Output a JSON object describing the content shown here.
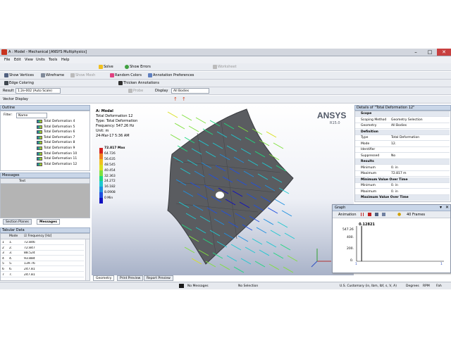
{
  "window": {
    "title": "A : Model - Mechanical [ANSYS Multiphysics]"
  },
  "menu": [
    "File",
    "Edit",
    "View",
    "Units",
    "Tools",
    "Help"
  ],
  "toolbar1": {
    "solve": "Solve",
    "show_errors": "Show Errors",
    "worksheet": "Worksheet"
  },
  "toolbar2": {
    "show_vertices": "Show Vertices",
    "wireframe": "Wireframe",
    "show_mesh": "Show Mesh",
    "random_colors": "Random Colors",
    "annotation_prefs": "Annotation Preferences"
  },
  "toolbar3": {
    "edge_coloring": "Edge Coloring",
    "thicken_annotations": "Thicken Annotations"
  },
  "toolbar4": {
    "result_label": "Result",
    "result_scale": "1.2e-002 (Auto Scale)",
    "probe": "Probe",
    "display_label": "Display",
    "display_value": "All Bodies"
  },
  "toolbar5": {
    "vector_display": "Vector Display"
  },
  "outline": {
    "header": "Outline",
    "filter_label": "Filter:",
    "filter_value": "Name",
    "items": [
      "Total Deformation 4",
      "Total Deformation 5",
      "Total Deformation 6",
      "Total Deformation 7",
      "Total Deformation 8",
      "Total Deformation 9",
      "Total Deformation 10",
      "Total Deformation 11",
      "Total Deformation 12"
    ]
  },
  "messages": {
    "header": "Messages",
    "column": "Text"
  },
  "bottom_tabs": {
    "section_planes": "Section Planes",
    "messages": "Messages"
  },
  "tabular": {
    "header": "Tabular Data",
    "col_mode": "Mode",
    "col_freq": "Frequency [Hz]",
    "rows": [
      {
        "n": "1",
        "mode": "1.",
        "freq": "72.846"
      },
      {
        "n": "2",
        "mode": "2.",
        "freq": "72.847"
      },
      {
        "n": "3",
        "mode": "3.",
        "freq": "88.524"
      },
      {
        "n": "4",
        "mode": "4.",
        "freq": "93.884"
      },
      {
        "n": "5",
        "mode": "5.",
        "freq": "139.76"
      },
      {
        "n": "6",
        "mode": "6.",
        "freq": "247.81"
      },
      {
        "n": "7",
        "mode": "7.",
        "freq": "247.81"
      }
    ]
  },
  "viewport": {
    "info": [
      "A: Modal",
      "Total Deformation 12",
      "Type: Total Deformation",
      "Frequency: 547.26 Hz",
      "Unit: m",
      "24-Mar-17 5:36 AM"
    ],
    "brand": "ANSYS",
    "version": "R15.0",
    "legend": [
      {
        "label": "72.817 Max",
        "color": "#d42020"
      },
      {
        "label": "64.726",
        "color": "#f08020"
      },
      {
        "label": "56.635",
        "color": "#f0c020"
      },
      {
        "label": "48.545",
        "color": "#d8e020"
      },
      {
        "label": "40.454",
        "color": "#80e040"
      },
      {
        "label": "32.363",
        "color": "#20d880"
      },
      {
        "label": "24.272",
        "color": "#20c8d0"
      },
      {
        "label": "16.182",
        "color": "#2090e0"
      },
      {
        "label": "8.0908",
        "color": "#2050e0"
      },
      {
        "label": "0 Min",
        "color": "#1010c0"
      }
    ]
  },
  "view_tabs": {
    "geometry": "Geometry",
    "print_preview": "Print Preview",
    "report_preview": "Report Preview"
  },
  "details": {
    "header": "Details of \"Total Deformation 12\"",
    "rows": [
      {
        "type": "sec",
        "k": "Scope"
      },
      {
        "type": "row",
        "k": "Scoping Method",
        "v": "Geometry Selection"
      },
      {
        "type": "row",
        "k": "Geometry",
        "v": "All Bodies"
      },
      {
        "type": "sec",
        "k": "Definition"
      },
      {
        "type": "row",
        "k": "Type",
        "v": "Total Deformation"
      },
      {
        "type": "row",
        "k": "Mode",
        "v": "12."
      },
      {
        "type": "row",
        "k": "Identifier",
        "v": ""
      },
      {
        "type": "row",
        "k": "Suppressed",
        "v": "No"
      },
      {
        "type": "sec",
        "k": "Results"
      },
      {
        "type": "row",
        "k": "Minimum",
        "v": "0. in"
      },
      {
        "type": "row",
        "k": "Maximum",
        "v": "72.817 m"
      },
      {
        "type": "sec",
        "k": "Minimum Value Over Time"
      },
      {
        "type": "row",
        "k": "Minimum",
        "v": "0. in"
      },
      {
        "type": "row",
        "k": "Maximum",
        "v": "0. in"
      },
      {
        "type": "sec",
        "k": "Maximum Value Over Time"
      }
    ]
  },
  "graph": {
    "header": "Graph",
    "animation": "Animation",
    "frames": "40 Frames",
    "marker": "0.12821",
    "ytick_top": "547.26",
    "ytick_mid": "400.",
    "ytick_low": "200.",
    "ytick_zero": "0.",
    "xtick_end": "1",
    "xtick_start": "1"
  },
  "status": {
    "messages": "No Messages",
    "selection": "No Selection",
    "units": "U.S. Customary (in, lbm, lbf, s, V, A)",
    "degrees": "Degrees",
    "rpm": "RPM",
    "temp": "Fah"
  }
}
